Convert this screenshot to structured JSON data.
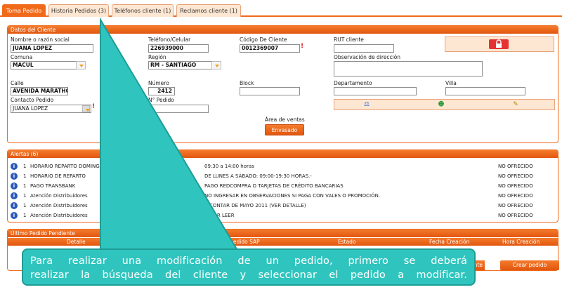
{
  "tabs": [
    {
      "label": "Toma Pedido",
      "active": true
    },
    {
      "label": "Historia Pedidos (3)",
      "active": false
    },
    {
      "label": "Teléfonos cliente (1)",
      "active": false
    },
    {
      "label": "Reclamos cliente (1)",
      "active": false
    }
  ],
  "cliente": {
    "header": "Datos del Cliente",
    "nombre_label": "Nombre o razón social",
    "nombre_value": "JUANA LOPEZ",
    "telefono_label": "Teléfono/Celular",
    "telefono_value": "226939000",
    "codigo_label": "Código De Cliente",
    "codigo_value": "0012369007",
    "rut_label": "RUT cliente",
    "rut_value": "",
    "comuna_label": "Comuna",
    "comuna_value": "MACUL",
    "region_label": "Región",
    "region_value": "RM - SANTIAGO",
    "observacion_label": "Observación de dirección",
    "calle_label": "Calle",
    "calle_value": "AVENIDA MARATHON",
    "numero_label": "Número",
    "numero_value": "2412",
    "block_label": "Block",
    "departamento_label": "Departamento",
    "villa_label": "Villa",
    "contacto_label": "Contacto Pedido",
    "contacto_value": "JUANA LOPEZ",
    "npedido_label": "N° Pedido",
    "area_label": "Área de ventas",
    "area_button": "Envasado",
    "required_mark": "!"
  },
  "alertas": {
    "header": "Alertas (6)",
    "rows": [
      {
        "num": "1",
        "name": "HORARIO REPARTO DOMINGO",
        "desc": "09:30 a 14:00 horas",
        "status": "NO OFRECIDO"
      },
      {
        "num": "1",
        "name": "HORARIO DE REPARTO",
        "desc": "DE LUNES A SÁBADO: 09:00-19:30 HORAS.-",
        "status": "NO OFRECIDO"
      },
      {
        "num": "1",
        "name": "PAGO TRANSBANK",
        "desc": "PAGO REDCOMPRA O TARJETAS DE CRÉDITO BANCARIAS",
        "status": "NO OFRECIDO"
      },
      {
        "num": "1",
        "name": "Atención Distribuidores",
        "desc": "NO INGRESAR EN OBSERVACIONES SI PAGA CON VALES O PROMOCIÓN.",
        "status": "NO OFRECIDO"
      },
      {
        "num": "1",
        "name": "Atención Distribuidores",
        "desc": "A CONTAR DE MAYO 2011 (VER DETALLE)",
        "status": "NO OFRECIDO"
      },
      {
        "num": "1",
        "name": "Atención Distribuidores",
        "desc": "FAVOR LEER",
        "status": "NO OFRECIDO"
      }
    ]
  },
  "pendiente": {
    "header": "Último Pedido Pendiente",
    "columns": [
      "Detalle",
      "Número pedido SAP",
      "Estado",
      "Fecha Creación",
      "Hora Creación"
    ],
    "partial_button": "nte",
    "crear_button": "Crear pedido"
  },
  "caption": {
    "line1": "Para realizar una modificación de un pedido, primero se deberá",
    "line2": "realizar la búsqueda del cliente y seleccionar el pedido a modificar."
  },
  "colors": {
    "accent": "#f06a1a",
    "callout": "#2fc5be"
  }
}
